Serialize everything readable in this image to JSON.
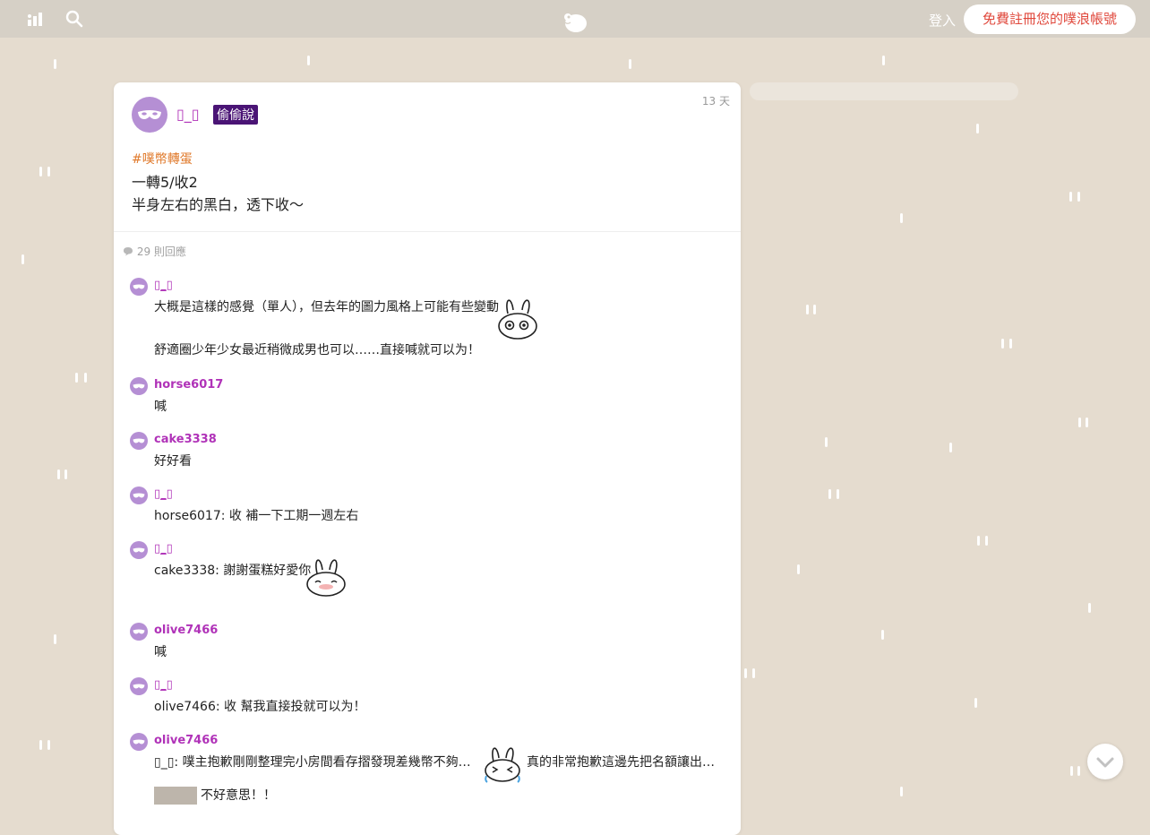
{
  "header": {
    "login_label": "登入",
    "signup_label": "免費註冊您的噗浪帳號"
  },
  "post": {
    "author": "▯_▯",
    "anon_badge": "偷偷說",
    "time": "13 天",
    "tag": "#噗幣轉蛋",
    "line1": "一轉5/收2",
    "line2": "半身左右的黑白，透下收～",
    "response_count": "29 則回應"
  },
  "responses": [
    {
      "name": "▯_▯",
      "text": "大概是這樣的感覺（單人），但去年的圖力風格上可能有些變動",
      "text2": "舒適圈少年少女最近稍微成男也可以……直接喊就可以为！"
    },
    {
      "name": "horse6017",
      "text": "喊"
    },
    {
      "name": "cake3338",
      "text": "好好看"
    },
    {
      "name": "▯_▯",
      "text": "horse6017: 收 補一下工期一週左右"
    },
    {
      "name": "▯_▯",
      "text": "cake3338: 謝謝蛋糕好愛你"
    },
    {
      "name": "olive7466",
      "text": "喊"
    },
    {
      "name": "▯_▯",
      "text": "olive7466: 收 幫我直接投就可以为！"
    },
    {
      "name": "olive7466",
      "text": "▯_▯: 噗主抱歉剛剛整理完小房間看存摺發現差幾幣不夠…",
      "text_b": "真的非常抱歉這邊先把名額讓出…",
      "text2": "不好意思！！"
    }
  ],
  "icons": {
    "dashboard": "stats-icon",
    "search": "search-icon",
    "logo": "plurk-logo",
    "scroll": "chevron-down-icon"
  },
  "colors": {
    "background": "#e5dccf",
    "accent_name": "#b032b8",
    "signup_text": "#e0483c",
    "tag": "#e07a2c",
    "badge": "#4a1475"
  }
}
